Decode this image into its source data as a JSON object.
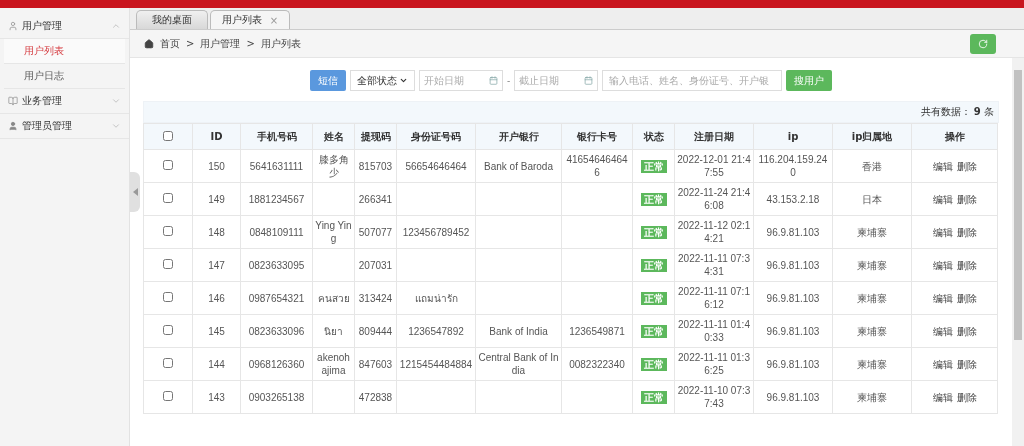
{
  "sidebar": {
    "groups": [
      {
        "label": "用户管理",
        "expanded": true,
        "children": [
          {
            "label": "用户列表",
            "selected": true
          },
          {
            "label": "用户日志",
            "selected": false
          }
        ]
      },
      {
        "label": "业务管理",
        "expanded": false
      },
      {
        "label": "管理员管理",
        "expanded": false
      }
    ]
  },
  "tabs": [
    {
      "label": "我的桌面",
      "selected": false
    },
    {
      "label": "用户列表",
      "selected": true,
      "close": "×"
    }
  ],
  "breadcrumb": {
    "separator": ">",
    "items": [
      "首页",
      "用户管理",
      "用户列表"
    ]
  },
  "toolbar": {
    "sms_button": "短信",
    "status_select": "全部状态",
    "start_date": {
      "placeholder": "开始日期"
    },
    "range_separator": "-",
    "end_date": {
      "placeholder": "截止日期"
    },
    "search": {
      "placeholder": "输入电话、姓名、身份证号、开户银"
    },
    "search_button": "搜用户"
  },
  "total": {
    "label": "共有数据：",
    "count": "9",
    "unit": "条"
  },
  "table": {
    "select_all_checked": false,
    "columns": [
      "ID",
      "手机号码",
      "姓名",
      "提现码",
      "身份证号码",
      "开户银行",
      "银行卡号",
      "状态",
      "注册日期",
      "ip",
      "ip归属地",
      "操作"
    ],
    "rows": [
      {
        "checked": false,
        "id": "150",
        "phone": "5641631111",
        "name": "膝多角少",
        "code": "815703",
        "id_card": "56654646464",
        "bank": "Bank of Baroda",
        "card": "416546464646",
        "status": "正常",
        "date": "2022-12-01 21:47:55",
        "ip": "116.204.159.240",
        "location": "香港",
        "actions": [
          "编辑",
          "删除"
        ]
      },
      {
        "checked": false,
        "id": "149",
        "phone": "1881234567",
        "name": "",
        "code": "266341",
        "id_card": "",
        "bank": "",
        "card": "",
        "status": "正常",
        "date": "2022-11-24 21:46:08",
        "ip": "43.153.2.18",
        "location": "日本",
        "actions": [
          "编辑",
          "删除"
        ]
      },
      {
        "checked": false,
        "id": "148",
        "phone": "0848109111",
        "name": "Ying Ying",
        "code": "507077",
        "id_card": "123456789452",
        "bank": "",
        "card": "",
        "status": "正常",
        "date": "2022-11-12 02:14:21",
        "ip": "96.9.81.103",
        "location": "柬埔寨",
        "actions": [
          "编辑",
          "删除"
        ]
      },
      {
        "checked": false,
        "id": "147",
        "phone": "0823633095",
        "name": "",
        "code": "207031",
        "id_card": "",
        "bank": "",
        "card": "",
        "status": "正常",
        "date": "2022-11-11 07:34:31",
        "ip": "96.9.81.103",
        "location": "柬埔寨",
        "actions": [
          "编辑",
          "删除"
        ]
      },
      {
        "checked": false,
        "id": "146",
        "phone": "0987654321",
        "name": "คนสวย",
        "code": "313424",
        "id_card": "แถมน่ารัก",
        "bank": "",
        "card": "",
        "status": "正常",
        "date": "2022-11-11 07:16:12",
        "ip": "96.9.81.103",
        "location": "柬埔寨",
        "actions": [
          "编辑",
          "删除"
        ]
      },
      {
        "checked": false,
        "id": "145",
        "phone": "0823633096",
        "name": "นิยา",
        "code": "809444",
        "id_card": "1236547892",
        "bank": "Bank of India",
        "card": "1236549871",
        "status": "正常",
        "date": "2022-11-11 01:40:33",
        "ip": "96.9.81.103",
        "location": "柬埔寨",
        "actions": [
          "编辑",
          "删除"
        ]
      },
      {
        "checked": false,
        "id": "144",
        "phone": "0968126360",
        "name": "akenohajima",
        "code": "847603",
        "id_card": "1215454484884",
        "bank": "Central Bank of India",
        "card": "0082322340",
        "status": "正常",
        "date": "2022-11-11 01:36:25",
        "ip": "96.9.81.103",
        "location": "柬埔寨",
        "actions": [
          "编辑",
          "删除"
        ]
      },
      {
        "checked": false,
        "id": "143",
        "phone": "0903265138",
        "name": "",
        "code": "472838",
        "id_card": "",
        "bank": "",
        "card": "",
        "status": "正常",
        "date": "2022-11-10 07:37:43",
        "ip": "96.9.81.103",
        "location": "柬埔寨",
        "actions": [
          "编辑",
          "删除"
        ]
      }
    ]
  }
}
